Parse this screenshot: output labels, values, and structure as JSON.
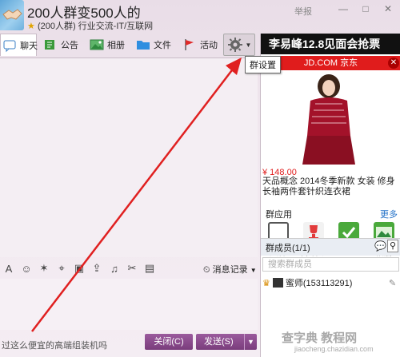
{
  "header": {
    "title": "200人群变500人的",
    "subtitle": "(200人群) 行业交流-IT/互联网",
    "report": "举报",
    "minimize": "—",
    "maximize": "□",
    "close": "✕"
  },
  "toolbar": {
    "tabs": [
      {
        "label": "聊天",
        "icon": "chat-icon"
      },
      {
        "label": "公告",
        "icon": "announcement-icon"
      },
      {
        "label": "相册",
        "icon": "album-icon"
      },
      {
        "label": "文件",
        "icon": "folder-icon"
      },
      {
        "label": "活动",
        "icon": "flag-icon"
      }
    ],
    "settings_tooltip": "群设置"
  },
  "right_panel": {
    "promo_banner": "李易峰12.8见面会抢票",
    "jd_ad": {
      "brand": "JD.COM 京东",
      "price": "¥ 148.00",
      "description": "天品概念 2014冬季新款 女装 修身长袖两件套针织连衣裙"
    },
    "apps": {
      "title": "群应用",
      "more": "更多",
      "items": [
        "文件",
        "群活动",
        "签到",
        "相册"
      ]
    },
    "members": {
      "title": "群成员(1/1)",
      "search_placeholder": "搜索群成员",
      "list": [
        {
          "name": "蜜师(153113291)"
        }
      ]
    }
  },
  "input": {
    "history": "消息记录",
    "ad_text": "过这么便宜的高端组装机吗",
    "close_button": "关闭(C)",
    "send_button": "发送(S)"
  },
  "watermark": {
    "line1": "查字典 教程网",
    "line2": "jiaocheng.chazidian.com"
  },
  "colors": {
    "accent": "#8a4a8c",
    "jd_red": "#e01c1c",
    "link": "#2472c8",
    "arrow": "#e02020"
  }
}
